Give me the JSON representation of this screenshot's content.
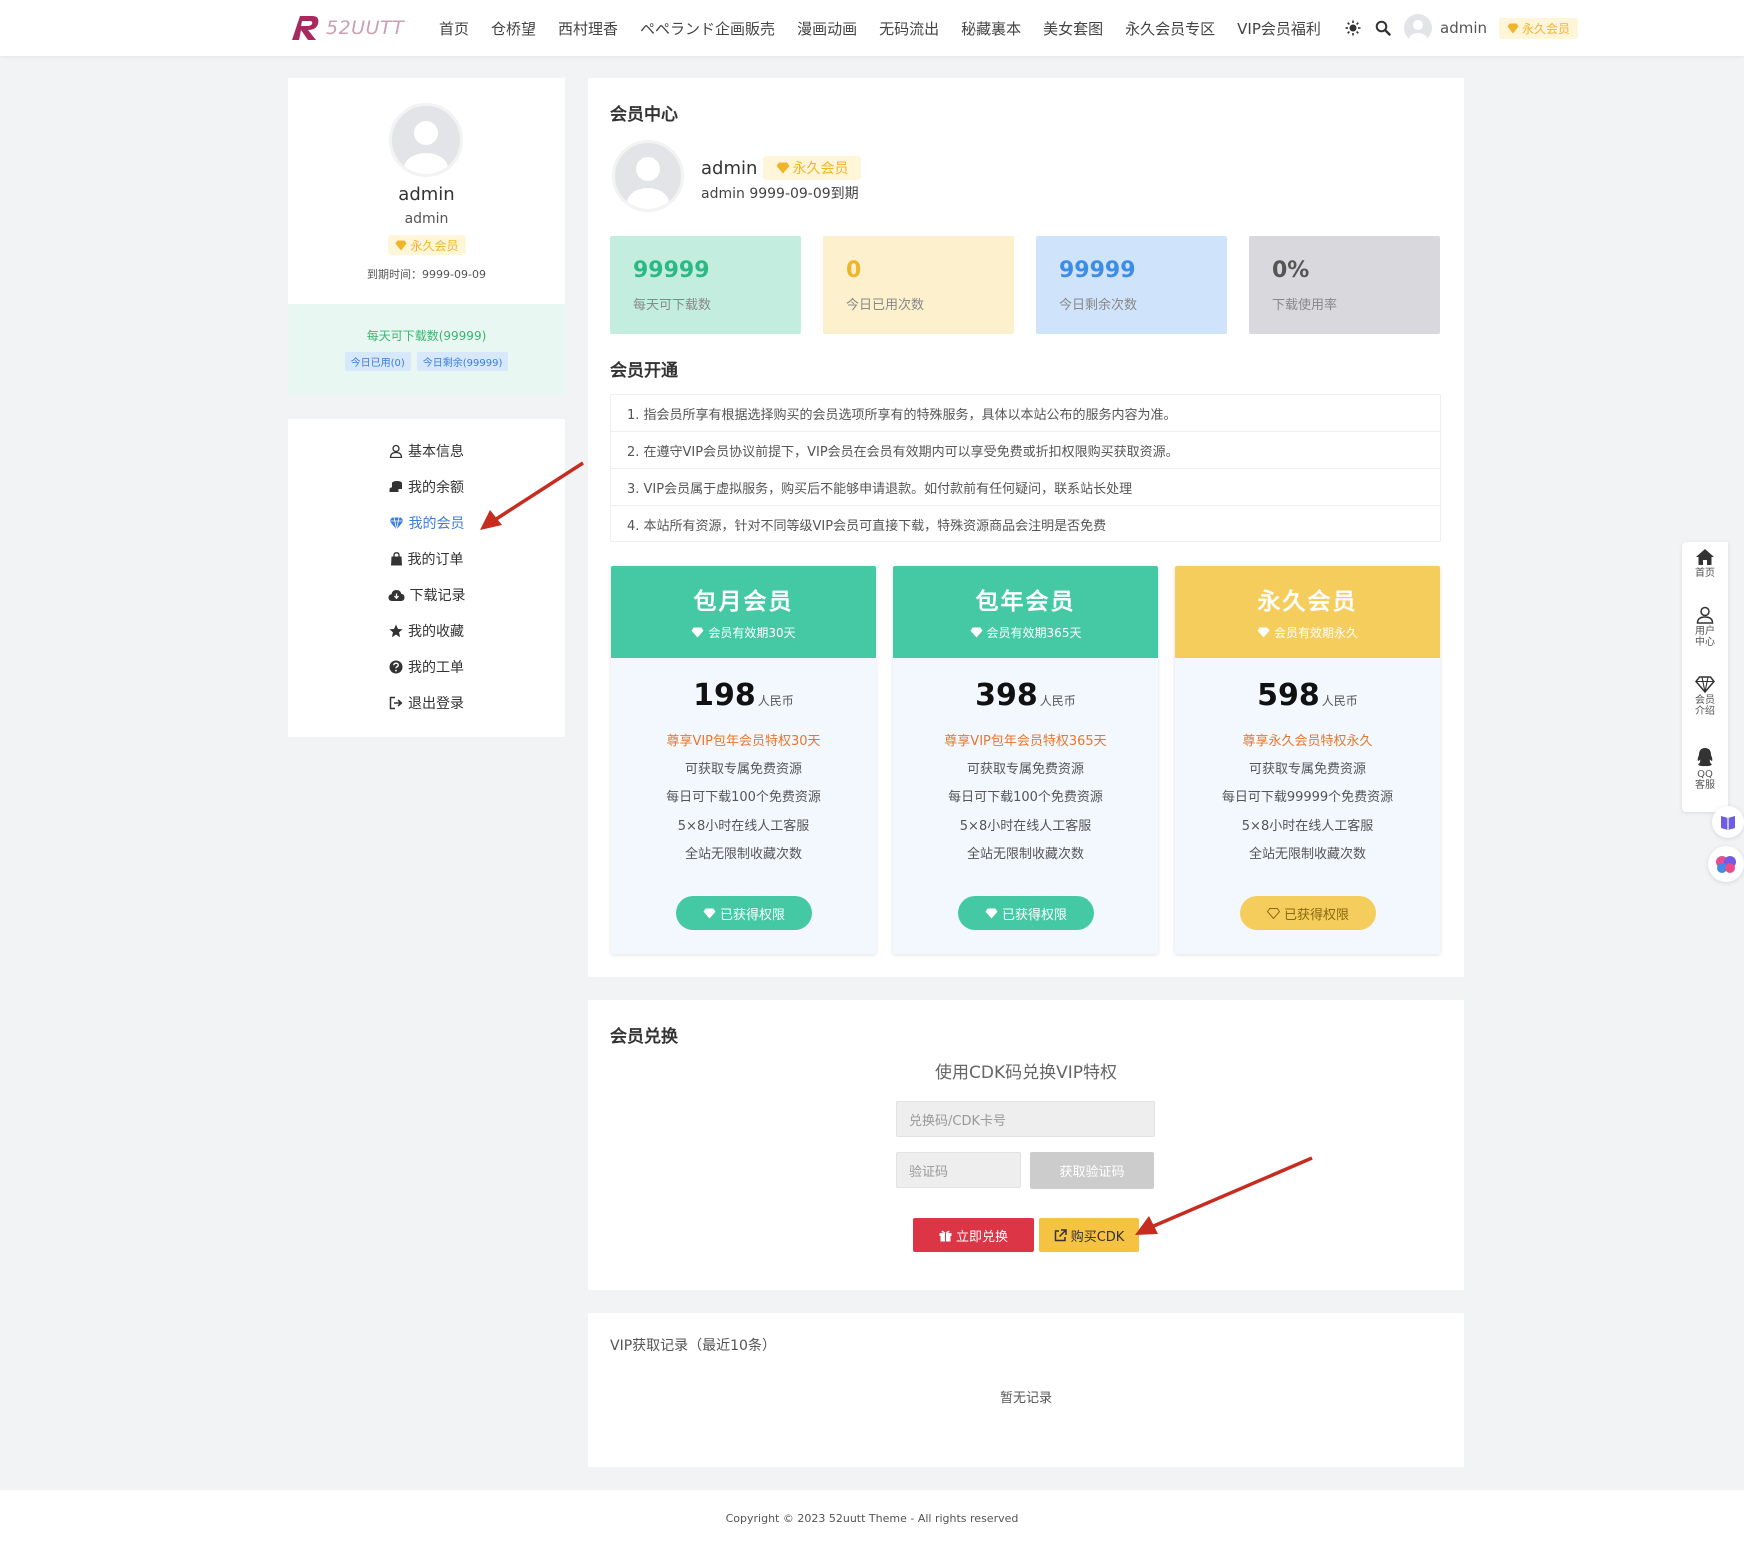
{
  "header": {
    "logo_text": "52UUTT",
    "nav": [
      "首页",
      "仓桥望",
      "西村理香",
      "ペペランド企画販売",
      "漫画动画",
      "无码流出",
      "秘藏裏本",
      "美女套图",
      "永久会员专区",
      "VIP会员福利"
    ],
    "username": "admin",
    "vip_badge": "永久会员"
  },
  "profile": {
    "name": "admin",
    "sub": "admin",
    "badge": "永久会员",
    "expiry": "到期时间：9999-09-09",
    "daily": "每天可下载数(99999)",
    "used": "今日已用(0)",
    "remain": "今日剩余(99999)"
  },
  "menu": {
    "items": [
      "基本信息",
      "我的余额",
      "我的会员",
      "我的订单",
      "下载记录",
      "我的收藏",
      "我的工单",
      "退出登录"
    ],
    "active_index": 2
  },
  "member": {
    "title": "会员中心",
    "name": "admin",
    "badge": "永久会员",
    "expiry": "admin 9999-09-09到期",
    "stats": [
      {
        "value": "99999",
        "label": "每天可下载数",
        "bg": "#c3eedf",
        "fg": "#2eb886"
      },
      {
        "value": "0",
        "label": "今日已用次数",
        "bg": "#fdf0cc",
        "fg": "#f0b429"
      },
      {
        "value": "99999",
        "label": "今日剩余次数",
        "bg": "#cfe3fb",
        "fg": "#3d8de6"
      },
      {
        "value": "0%",
        "label": "下载使用率",
        "bg": "#d9d9dd",
        "fg": "#555555"
      }
    ]
  },
  "open": {
    "title": "会员开通",
    "notes": [
      "1. 指会员所享有根据选择购买的会员选项所享有的特殊服务，具体以本站公布的服务内容为准。",
      "2. 在遵守VIP会员协议前提下，VIP会员在会员有效期内可以享受免费或折扣权限购买获取资源。",
      "3. VIP会员属于虚拟服务，购买后不能够申请退款。如付款前有任何疑问，联系站长处理",
      "4. 本站所有资源，针对不同等级VIP会员可直接下载，特殊资源商品会注明是否免费"
    ]
  },
  "plans": [
    {
      "title": "包月会员",
      "sub": "会员有效期30天",
      "price": "198",
      "unit": "人民币",
      "highlight": "尊享VIP包年会员特权30天",
      "features": [
        "可获取专属免费资源",
        "每日可下载100个免费资源",
        "5×8小时在线人工客服",
        "全站无限制收藏次数"
      ],
      "button": "已获得权限",
      "color": "#45c9a5",
      "btn_color": "#45c9a5"
    },
    {
      "title": "包年会员",
      "sub": "会员有效期365天",
      "price": "398",
      "unit": "人民币",
      "highlight": "尊享VIP包年会员特权365天",
      "features": [
        "可获取专属免费资源",
        "每日可下载100个免费资源",
        "5×8小时在线人工客服",
        "全站无限制收藏次数"
      ],
      "button": "已获得权限",
      "color": "#45c9a5",
      "btn_color": "#45c9a5"
    },
    {
      "title": "永久会员",
      "sub": "会员有效期永久",
      "price": "598",
      "unit": "人民币",
      "highlight": "尊享永久会员特权永久",
      "features": [
        "可获取专属免费资源",
        "每日可下载99999个免费资源",
        "5×8小时在线人工客服",
        "全站无限制收藏次数"
      ],
      "button": "已获得权限",
      "color": "#f5cd5c",
      "btn_color": "#f5cd5c"
    }
  ],
  "redeem": {
    "title": "会员兑换",
    "subtitle": "使用CDK码兑换VIP特权",
    "cdk_placeholder": "兑换码/CDK卡号",
    "code_placeholder": "验证码",
    "get_code": "获取验证码",
    "redeem_btn": "立即兑换",
    "buy_btn": "购买CDK"
  },
  "records": {
    "title": "VIP获取记录（最近10条）",
    "empty": "暂无记录"
  },
  "footer": "Copyright © 2023 52uutt Theme - All rights reserved",
  "float_bar": [
    "首页",
    "用户中心",
    "会员介绍",
    "QQ客服"
  ]
}
